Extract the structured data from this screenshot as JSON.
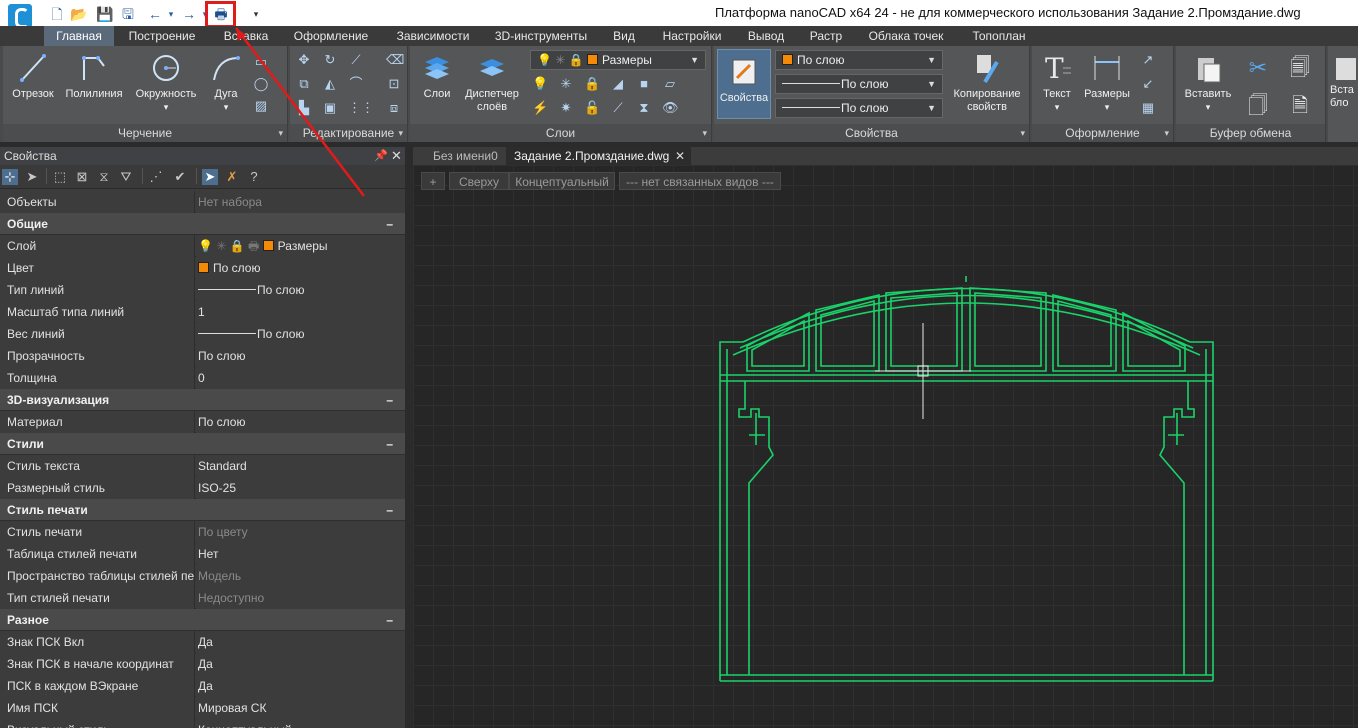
{
  "window": {
    "title": "Платформа nanoCAD x64 24 - не для коммерческого использования Задание 2.Промздание.dwg"
  },
  "quick_access": {
    "icons": [
      "new-icon",
      "open-icon",
      "save-icon",
      "save-as-icon",
      "undo-icon",
      "redo-icon",
      "print-icon",
      "more-icon"
    ]
  },
  "ribbon_tabs": [
    "Главная",
    "Построение",
    "Вставка",
    "Оформление",
    "Зависимости",
    "3D-инструменты",
    "Вид",
    "Настройки",
    "Вывод",
    "Растр",
    "Облака точек",
    "Топоплан"
  ],
  "ribbon": {
    "drawing": {
      "label": "Черчение",
      "buttons": [
        "Отрезок",
        "Полилиния",
        "Окружность",
        "Дуга"
      ]
    },
    "editing": {
      "label": "Редактирование"
    },
    "layers": {
      "label": "Слои",
      "buttons": [
        "Слои",
        "Диспетчер слоёв"
      ],
      "current_layer": "Размеры",
      "current_layer_color": "#f58a07"
    },
    "properties": {
      "label": "Свойства",
      "main_button": "Свойства",
      "color_value": "По слою",
      "linetype_value": "По слою",
      "lineweight_value": "По слою",
      "copy_button": "Копирование свойств"
    },
    "annotation": {
      "label": "Оформление",
      "buttons": [
        "Текст",
        "Размеры"
      ]
    },
    "clipboard": {
      "label": "Буфер обмена",
      "buttons": [
        "Вставить",
        "Вста бло"
      ]
    }
  },
  "properties_panel": {
    "title": "Свойства",
    "rows": [
      {
        "type": "prop",
        "key": "Объекты",
        "value": "Нет набора",
        "dim": true
      },
      {
        "type": "cat",
        "key": "Общие"
      },
      {
        "type": "prop",
        "key": "Слой",
        "value": "Размеры",
        "kind": "layer"
      },
      {
        "type": "prop",
        "key": "Цвет",
        "value": "По слою",
        "kind": "color"
      },
      {
        "type": "prop",
        "key": "Тип линий",
        "value": "По слою",
        "kind": "line"
      },
      {
        "type": "prop",
        "key": "Масштаб типа линий",
        "value": "1"
      },
      {
        "type": "prop",
        "key": "Вес линий",
        "value": "По слою",
        "kind": "line"
      },
      {
        "type": "prop",
        "key": "Прозрачность",
        "value": "По слою"
      },
      {
        "type": "prop",
        "key": "Толщина",
        "value": "0"
      },
      {
        "type": "cat",
        "key": "3D-визуализация"
      },
      {
        "type": "prop",
        "key": "Материал",
        "value": "По слою"
      },
      {
        "type": "cat",
        "key": "Стили"
      },
      {
        "type": "prop",
        "key": "Стиль текста",
        "value": "Standard"
      },
      {
        "type": "prop",
        "key": "Размерный стиль",
        "value": "ISO-25"
      },
      {
        "type": "cat",
        "key": "Стиль печати"
      },
      {
        "type": "prop",
        "key": "Стиль печати",
        "value": "По цвету",
        "dim": true
      },
      {
        "type": "prop",
        "key": "Таблица стилей печати",
        "value": "Нет"
      },
      {
        "type": "prop",
        "key": "Пространство таблицы стилей пе...",
        "value": "Модель",
        "dim": true
      },
      {
        "type": "prop",
        "key": "Тип стилей печати",
        "value": "Недоступно",
        "dim": true
      },
      {
        "type": "cat",
        "key": "Разное"
      },
      {
        "type": "prop",
        "key": "Знак ПСК Вкл",
        "value": "Да"
      },
      {
        "type": "prop",
        "key": "Знак ПСК в начале координат",
        "value": "Да"
      },
      {
        "type": "prop",
        "key": "ПСК в каждом ВЭкране",
        "value": "Да"
      },
      {
        "type": "prop",
        "key": "Имя ПСК",
        "value": "Мировая СК"
      },
      {
        "type": "prop",
        "key": "Визуальный стиль",
        "value": "Концептуальный"
      }
    ],
    "category_toggle": "–"
  },
  "document_tabs": [
    {
      "label": "Без имени0",
      "active": false
    },
    {
      "label": "Задание 2.Промздание.dwg",
      "active": true
    }
  ],
  "viewport_controls": [
    "+",
    "Сверху",
    "Концептуальный",
    "--- нет связанных видов ---"
  ],
  "colors": {
    "drawing_lines": "#19d36a",
    "annotation": "#e01b1b",
    "layer_swatch": "#f58a07"
  }
}
